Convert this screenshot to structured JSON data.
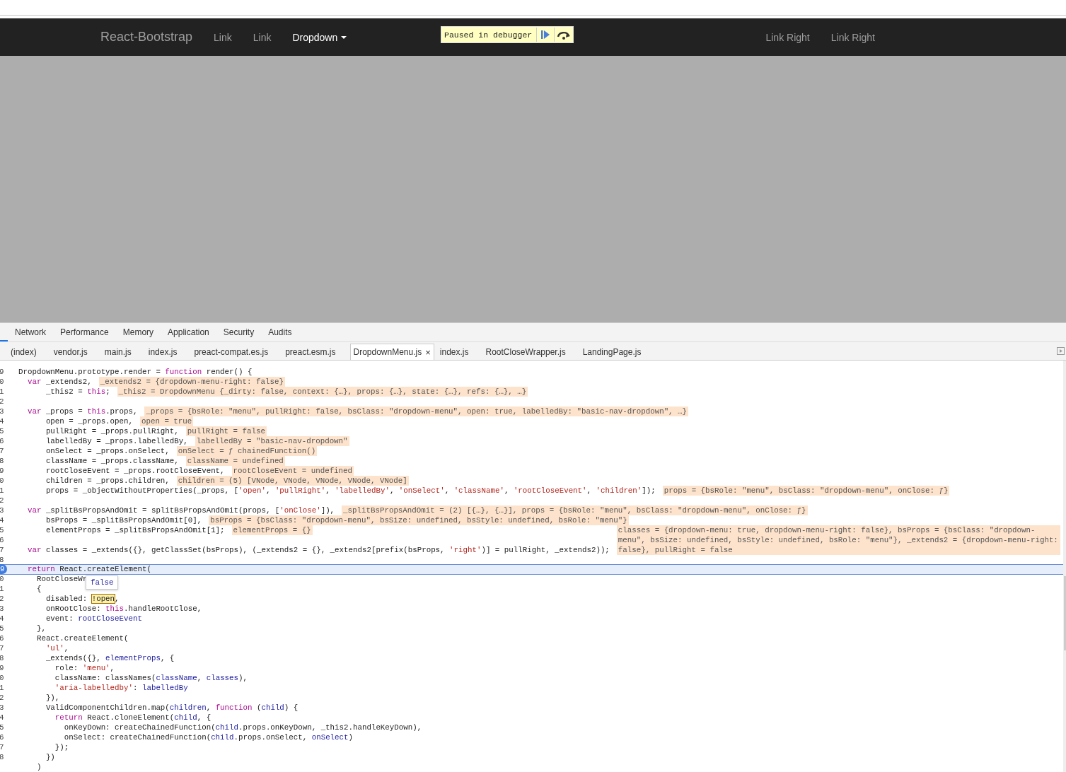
{
  "navbar": {
    "brand": "React-Bootstrap",
    "links": [
      {
        "label": "Link",
        "active": false
      },
      {
        "label": "Link",
        "active": false
      },
      {
        "label": "Dropdown",
        "active": true,
        "dropdown": true
      }
    ],
    "right_links": [
      {
        "label": "Link Right"
      },
      {
        "label": "Link Right"
      }
    ]
  },
  "debugger_badge": {
    "text": "Paused in debugger"
  },
  "devtools": {
    "panel_tabs": [
      {
        "label": "Network"
      },
      {
        "label": "Performance"
      },
      {
        "label": "Memory"
      },
      {
        "label": "Application"
      },
      {
        "label": "Security"
      },
      {
        "label": "Audits"
      }
    ],
    "file_tabs": [
      {
        "label": "(index)",
        "selected": false
      },
      {
        "label": "vendor.js",
        "selected": false
      },
      {
        "label": "main.js",
        "selected": false
      },
      {
        "label": "index.js",
        "selected": false
      },
      {
        "label": "preact-compat.es.js",
        "selected": false
      },
      {
        "label": "preact.esm.js",
        "selected": false
      },
      {
        "label": "DropdownMenu.js",
        "selected": true,
        "close": "×"
      },
      {
        "label": "index.js",
        "selected": false
      },
      {
        "label": "RootCloseWrapper.js",
        "selected": false
      },
      {
        "label": "LandingPage.js",
        "selected": false
      }
    ],
    "popover": {
      "text": "false"
    },
    "code": [
      {
        "gutter": "9",
        "tokens": [
          {
            "kind": "plain",
            "text": "DropdownMenu.prototype.render = "
          },
          {
            "kind": "keyword",
            "text": "function"
          },
          {
            "kind": "plain",
            "text": " render() {"
          }
        ]
      },
      {
        "gutter": "0",
        "tokens": [
          {
            "kind": "keyword",
            "text": "  var"
          },
          {
            "kind": "plain",
            "text": " _extends2,"
          }
        ],
        "value": "_extends2 = {dropdown-menu-right: false}"
      },
      {
        "gutter": "1",
        "tokens": [
          {
            "kind": "plain",
            "text": "      _this2 = "
          },
          {
            "kind": "keyword",
            "text": "this"
          },
          {
            "kind": "plain",
            "text": ";"
          }
        ],
        "value": "_this2 = DropdownMenu {_dirty: false, context: {…}, props: {…}, state: {…}, refs: {…}, …}"
      },
      {
        "gutter": "2"
      },
      {
        "gutter": "3",
        "tokens": [
          {
            "kind": "keyword",
            "text": "  var"
          },
          {
            "kind": "plain",
            "text": " _props = "
          },
          {
            "kind": "keyword",
            "text": "this"
          },
          {
            "kind": "plain",
            "text": ".props,"
          }
        ],
        "value": "_props = {bsRole: \"menu\", pullRight: false, bsClass: \"dropdown-menu\", open: true, labelledBy: \"basic-nav-dropdown\", …}"
      },
      {
        "gutter": "4",
        "tokens": [
          {
            "kind": "plain",
            "text": "      open = _props.open,"
          }
        ],
        "value": "open = true"
      },
      {
        "gutter": "5",
        "tokens": [
          {
            "kind": "plain",
            "text": "      pullRight = _props.pullRight,"
          }
        ],
        "value": "pullRight = false"
      },
      {
        "gutter": "6",
        "tokens": [
          {
            "kind": "plain",
            "text": "      labelledBy = _props.labelledBy,"
          }
        ],
        "value": "labelledBy = \"basic-nav-dropdown\""
      },
      {
        "gutter": "7",
        "tokens": [
          {
            "kind": "plain",
            "text": "      onSelect = _props.onSelect,"
          }
        ],
        "value": "onSelect = ƒ chainedFunction()"
      },
      {
        "gutter": "8",
        "tokens": [
          {
            "kind": "plain",
            "text": "      className = _props.className,"
          }
        ],
        "value": "className = undefined"
      },
      {
        "gutter": "9",
        "tokens": [
          {
            "kind": "plain",
            "text": "      rootCloseEvent = _props.rootCloseEvent,"
          }
        ],
        "value": "rootCloseEvent = undefined"
      },
      {
        "gutter": "0",
        "tokens": [
          {
            "kind": "plain",
            "text": "      children = _props.children,"
          }
        ],
        "value": "children = (5) [VNode, VNode, VNode, VNode, VNode]"
      },
      {
        "gutter": "1",
        "tokens": [
          {
            "kind": "plain",
            "text": "      props = _objectWithoutProperties(_props, ["
          },
          {
            "kind": "string",
            "text": "'open'"
          },
          {
            "kind": "plain",
            "text": ", "
          },
          {
            "kind": "string",
            "text": "'pullRight'"
          },
          {
            "kind": "plain",
            "text": ", "
          },
          {
            "kind": "string",
            "text": "'labelledBy'"
          },
          {
            "kind": "plain",
            "text": ", "
          },
          {
            "kind": "string",
            "text": "'onSelect'"
          },
          {
            "kind": "plain",
            "text": ", "
          },
          {
            "kind": "string",
            "text": "'className'"
          },
          {
            "kind": "plain",
            "text": ", "
          },
          {
            "kind": "string",
            "text": "'rootCloseEvent'"
          },
          {
            "kind": "plain",
            "text": ", "
          },
          {
            "kind": "string",
            "text": "'children'"
          },
          {
            "kind": "plain",
            "text": "]);"
          }
        ],
        "value": "props = {bsRole: \"menu\", bsClass: \"dropdown-menu\", onClose: ƒ}"
      },
      {
        "gutter": "2"
      },
      {
        "gutter": "3",
        "tokens": [
          {
            "kind": "keyword",
            "text": "  var"
          },
          {
            "kind": "plain",
            "text": " _splitBsPropsAndOmit = splitBsPropsAndOmit(props, ["
          },
          {
            "kind": "string",
            "text": "'onClose'"
          },
          {
            "kind": "plain",
            "text": "]),"
          }
        ],
        "value": "_splitBsPropsAndOmit = (2) [{…}, {…}], props = {bsRole: \"menu\", bsClass: \"dropdown-menu\", onClose: ƒ}"
      },
      {
        "gutter": "4",
        "tokens": [
          {
            "kind": "plain",
            "text": "      bsProps = _splitBsPropsAndOmit[0],"
          }
        ],
        "value": "bsProps = {bsClass: \"dropdown-menu\", bsSize: undefined, bsStyle: undefined, bsRole: \"menu\"}"
      },
      {
        "gutter": "5",
        "tokens": [
          {
            "kind": "plain",
            "text": "      elementProps = _splitBsPropsAndOmit[1];"
          }
        ],
        "value": "elementProps = {}"
      },
      {
        "gutter": "6"
      },
      {
        "gutter": "7",
        "tokens": [
          {
            "kind": "keyword",
            "text": "  var"
          },
          {
            "kind": "plain",
            "text": " classes = _extends({}, getClassSet(bsProps), (_extends2 = {}, _extends2[prefix(bsProps, "
          },
          {
            "kind": "string",
            "text": "'right'"
          },
          {
            "kind": "plain",
            "text": ")] = pullRight, _extends2));"
          }
        ],
        "value": "classes = {dropdown-menu: true, dropdown-menu-right: false}, bsProps = {bsClass: \"dropdown-menu\", bsSize: undefined, bsStyle: undefined, bsRole: \"menu\"}, _extends2 = {dropdown-menu-right: false}, pullRight = false"
      },
      {
        "gutter": "8"
      },
      {
        "gutter": "9",
        "paused": true,
        "tokens": [
          {
            "kind": "keyword",
            "text": "  return"
          },
          {
            "kind": "plain",
            "text": " React.createElement("
          }
        ]
      },
      {
        "gutter": "0",
        "popover": true,
        "tokens": [
          {
            "kind": "plain",
            "text": "    RootCloseWr"
          }
        ]
      },
      {
        "gutter": "1",
        "tokens": [
          {
            "kind": "plain",
            "text": "    {"
          }
        ]
      },
      {
        "gutter": "2",
        "tokens": [
          {
            "kind": "plain",
            "text": "      disabled: "
          },
          {
            "kind": "hover",
            "text": "!open"
          },
          {
            "kind": "plain",
            "text": ","
          }
        ]
      },
      {
        "gutter": "3",
        "tokens": [
          {
            "kind": "plain",
            "text": "      onRootClose: "
          },
          {
            "kind": "keyword",
            "text": "this"
          },
          {
            "kind": "plain",
            "text": ".handleRootClose,"
          }
        ]
      },
      {
        "gutter": "4",
        "tokens": [
          {
            "kind": "plain",
            "text": "      event: "
          },
          {
            "kind": "name",
            "text": "rootCloseEvent"
          }
        ]
      },
      {
        "gutter": "5",
        "tokens": [
          {
            "kind": "plain",
            "text": "    },"
          }
        ]
      },
      {
        "gutter": "6",
        "tokens": [
          {
            "kind": "plain",
            "text": "    React.createElement("
          }
        ]
      },
      {
        "gutter": "7",
        "tokens": [
          {
            "kind": "string",
            "text": "      'ul'"
          },
          {
            "kind": "plain",
            "text": ","
          }
        ]
      },
      {
        "gutter": "8",
        "tokens": [
          {
            "kind": "plain",
            "text": "      _extends({}, "
          },
          {
            "kind": "name",
            "text": "elementProps"
          },
          {
            "kind": "plain",
            "text": ", {"
          }
        ]
      },
      {
        "gutter": "9",
        "tokens": [
          {
            "kind": "plain",
            "text": "        role: "
          },
          {
            "kind": "string",
            "text": "'menu'"
          },
          {
            "kind": "plain",
            "text": ","
          }
        ]
      },
      {
        "gutter": "0",
        "tokens": [
          {
            "kind": "plain",
            "text": "        className: classNames("
          },
          {
            "kind": "name",
            "text": "className"
          },
          {
            "kind": "plain",
            "text": ", "
          },
          {
            "kind": "name",
            "text": "classes"
          },
          {
            "kind": "plain",
            "text": "),"
          }
        ]
      },
      {
        "gutter": "1",
        "tokens": [
          {
            "kind": "string",
            "text": "        'aria-labelledby'"
          },
          {
            "kind": "plain",
            "text": ": "
          },
          {
            "kind": "name",
            "text": "labelledBy"
          }
        ]
      },
      {
        "gutter": "2",
        "tokens": [
          {
            "kind": "plain",
            "text": "      }),"
          }
        ]
      },
      {
        "gutter": "3",
        "tokens": [
          {
            "kind": "plain",
            "text": "      ValidComponentChildren.map("
          },
          {
            "kind": "name",
            "text": "children"
          },
          {
            "kind": "plain",
            "text": ", "
          },
          {
            "kind": "keyword",
            "text": "function"
          },
          {
            "kind": "plain",
            "text": " ("
          },
          {
            "kind": "name",
            "text": "child"
          },
          {
            "kind": "plain",
            "text": ") {"
          }
        ]
      },
      {
        "gutter": "4",
        "tokens": [
          {
            "kind": "keyword",
            "text": "        return"
          },
          {
            "kind": "plain",
            "text": " React.cloneElement("
          },
          {
            "kind": "name",
            "text": "child"
          },
          {
            "kind": "plain",
            "text": ", {"
          }
        ]
      },
      {
        "gutter": "5",
        "tokens": [
          {
            "kind": "plain",
            "text": "          onKeyDown: createChainedFunction("
          },
          {
            "kind": "name",
            "text": "child"
          },
          {
            "kind": "plain",
            "text": ".props.onKeyDown, _this2.handleKeyDown),"
          }
        ]
      },
      {
        "gutter": "6",
        "tokens": [
          {
            "kind": "plain",
            "text": "          onSelect: createChainedFunction("
          },
          {
            "kind": "name",
            "text": "child"
          },
          {
            "kind": "plain",
            "text": ".props.onSelect, "
          },
          {
            "kind": "name",
            "text": "onSelect"
          },
          {
            "kind": "plain",
            "text": ")"
          }
        ]
      },
      {
        "gutter": "7",
        "tokens": [
          {
            "kind": "plain",
            "text": "        });"
          }
        ]
      },
      {
        "gutter": "8",
        "tokens": [
          {
            "kind": "plain",
            "text": "      })"
          }
        ]
      },
      {
        "tokens": [
          {
            "kind": "plain",
            "text": "    )"
          }
        ]
      }
    ]
  }
}
